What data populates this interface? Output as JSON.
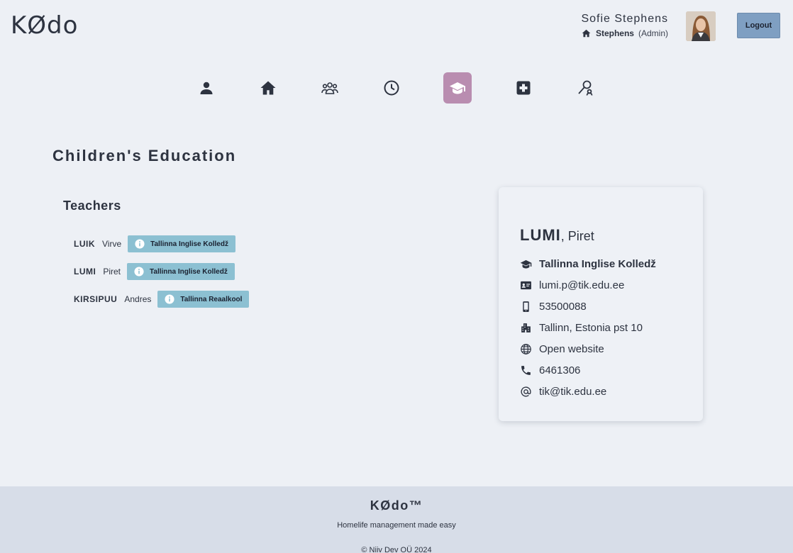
{
  "header": {
    "logo": "KØdo",
    "user_name": "Sofie Stephens",
    "household": "Stephens",
    "role": "(Admin)",
    "logout_label": "Logout"
  },
  "nav": {
    "items": [
      {
        "icon": "person-icon",
        "active": false
      },
      {
        "icon": "home-icon",
        "active": false
      },
      {
        "icon": "family-icon",
        "active": false
      },
      {
        "icon": "clock-icon",
        "active": false
      },
      {
        "icon": "education-icon",
        "active": true
      },
      {
        "icon": "medical-icon",
        "active": false
      },
      {
        "icon": "search-person-icon",
        "active": false
      }
    ]
  },
  "page": {
    "title": "Children's Education",
    "section_title": "Teachers"
  },
  "teachers": [
    {
      "last": "LUIK",
      "first": "Virve",
      "school": "Tallinna Inglise Kolledž"
    },
    {
      "last": "LUMI",
      "first": "Piret",
      "school": "Tallinna Inglise Kolledž"
    },
    {
      "last": "KIRSIPUU",
      "first": "Andres",
      "school": "Tallinna Reaalkool"
    }
  ],
  "detail": {
    "last": "LUMI",
    "first": ", Piret",
    "school": "Tallinna Inglise Kolledž",
    "email": "lumi.p@tik.edu.ee",
    "mobile": "53500088",
    "address": "Tallinn, Estonia pst 10",
    "website": "Open website",
    "phone": "6461306",
    "school_email": "tik@tik.edu.ee"
  },
  "footer": {
    "brand": "KØdo™",
    "tagline": "Homelife management made easy",
    "copyright": "© Niiv Dev OÜ 2024"
  },
  "colors": {
    "background": "#edf0f5",
    "active_nav": "#b98db0",
    "school_tag": "#8cc0d2",
    "logout": "#7f9fc2",
    "footer": "#d7dde8"
  }
}
